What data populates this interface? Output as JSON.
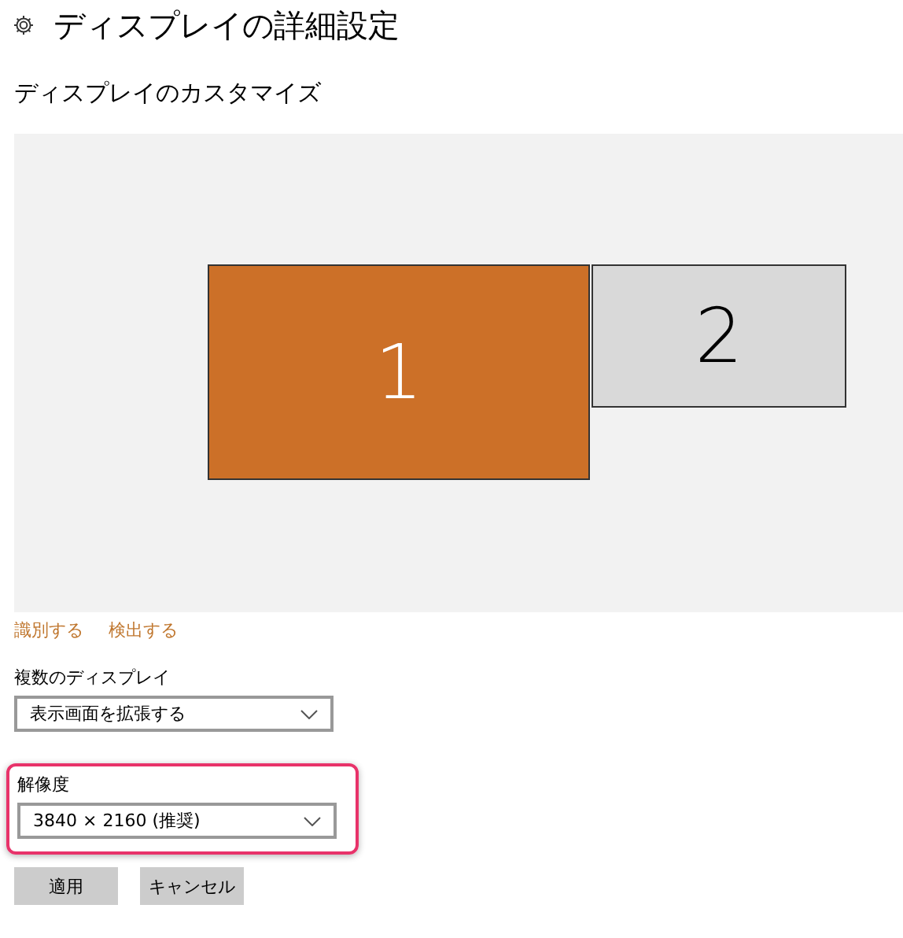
{
  "title": "ディスプレイの詳細設定",
  "section_title": "ディスプレイのカスタマイズ",
  "monitors": [
    {
      "label": "1",
      "selected": true
    },
    {
      "label": "2",
      "selected": false
    }
  ],
  "links": [
    "識別する",
    "検出する"
  ],
  "multiple_displays": {
    "label": "複数のディスプレイ",
    "value": "表示画面を拡張する"
  },
  "resolution": {
    "label": "解像度",
    "value": "3840 × 2160 (推奨)",
    "highlighted": true
  },
  "buttons": [
    "適用",
    "キャンセル"
  ]
}
